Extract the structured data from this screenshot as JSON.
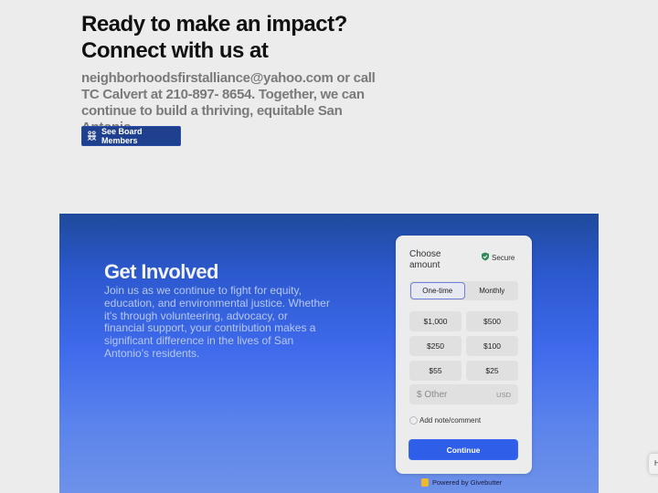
{
  "contact": {
    "headline": "Ready to make an impact? Connect with us at",
    "body": "neighborhoodsfirstalliance@yahoo.com or call TC Calvert at 210-897- 8654. Together, we can continue to build a thriving, equitable San Antonio.",
    "board_button_label": "See Board Members",
    "board_button_icon": "people-group-icon"
  },
  "get_involved": {
    "title": "Get Involved",
    "text": "Join us as we continue to fight for equity, education, and environmental justice. Whether it's through volunteering, advocacy, or financial support, your contribution makes a significant difference in the lives of San Antonio's residents."
  },
  "donation_widget": {
    "heading": "Choose amount",
    "secure_label": "Secure",
    "frequency_options": [
      "One-time",
      "Monthly"
    ],
    "selected_frequency": "One-time",
    "amounts": [
      "$1,000",
      "$500",
      "$250",
      "$100",
      "$55",
      "$25"
    ],
    "other_placeholder": "$ Other",
    "currency": "USD",
    "note_label": "Add note/comment",
    "note_checked": false,
    "continue_label": "Continue",
    "powered_by": "Powered by Givebutter"
  },
  "help_widget": {
    "label": "H"
  },
  "colors": {
    "board_button": "#1f3f8f",
    "continue_button": "#2f5fe8",
    "secure_shield": "#2e8b57"
  }
}
